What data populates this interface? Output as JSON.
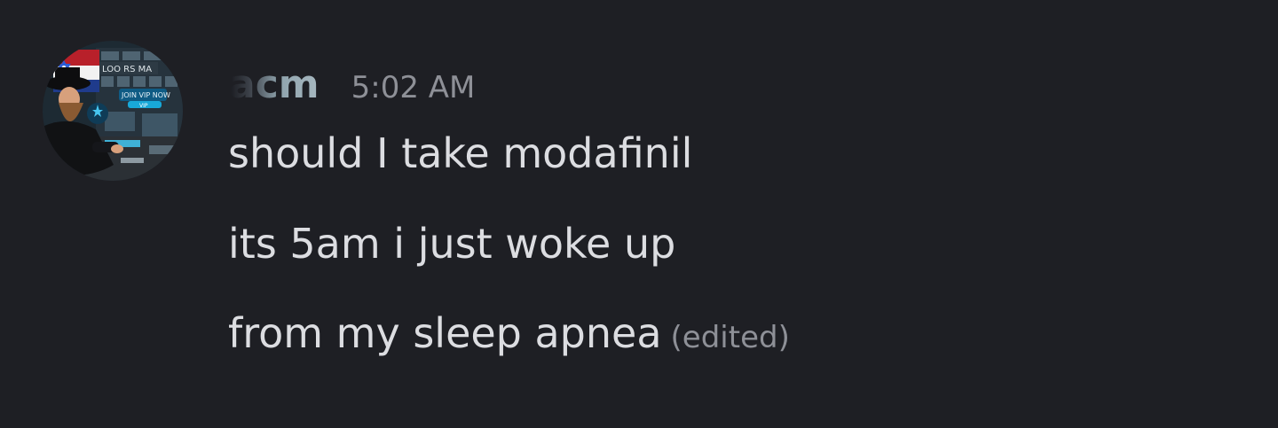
{
  "message": {
    "author": "acm",
    "timestamp": "5:02 AM",
    "lines": [
      "should I take modafinil",
      "its 5am i just woke up",
      "from my sleep apnea"
    ],
    "edited_label": "(edited)"
  },
  "avatar": {
    "sign_top": "LOO RS MA",
    "sign_button": "JOIN VIP NOW",
    "sign_sub": "VIP",
    "icon": "profile-picture"
  },
  "colors": {
    "background": "#1e1f24",
    "message_text": "#dcdde1",
    "muted_text": "#8e9097"
  }
}
